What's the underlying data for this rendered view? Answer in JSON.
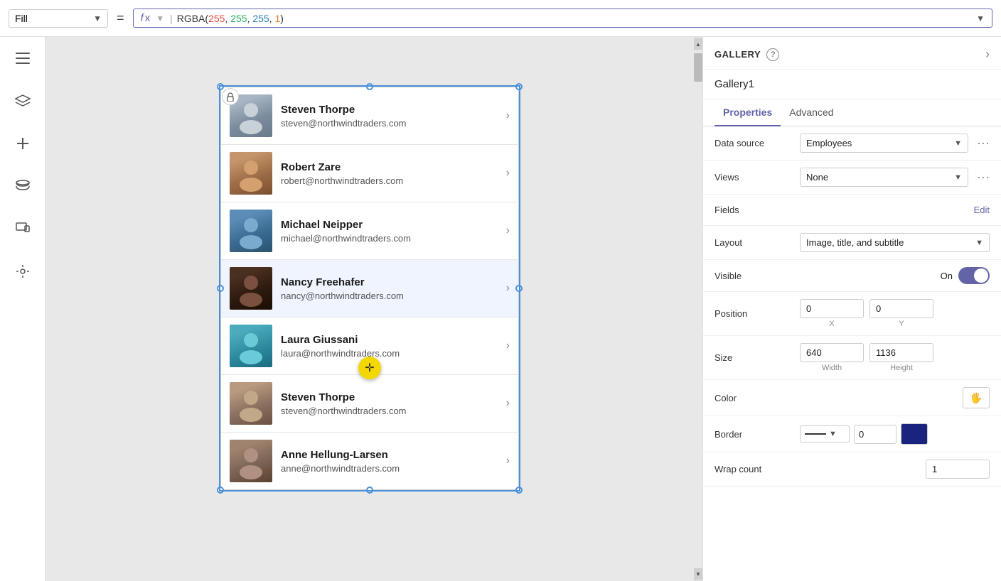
{
  "topbar": {
    "fill_label": "Fill",
    "equals": "=",
    "fx_label": "fx",
    "formula": "RGBA(255, 255, 255, 1)",
    "formula_parts": {
      "prefix": "RGBA(",
      "r": "255",
      "comma1": ", ",
      "g": "255",
      "comma2": ", ",
      "b": "255",
      "comma3": ", ",
      "a": "1",
      "suffix": ")"
    }
  },
  "sidebar": {
    "icons": [
      "menu",
      "layers",
      "plus",
      "database",
      "screen",
      "tools"
    ]
  },
  "gallery": {
    "title": "GALLERY",
    "help": "?",
    "name": "Gallery1",
    "items": [
      {
        "name": "Steven Thorpe",
        "email": "steven@northwindtraders.com",
        "avatar_color": "#8B9BB0"
      },
      {
        "name": "Robert Zare",
        "email": "robert@northwindtraders.com",
        "avatar_color": "#C4956A"
      },
      {
        "name": "Michael Neipper",
        "email": "michael@northwindtraders.com",
        "avatar_color": "#5B8DB8"
      },
      {
        "name": "Nancy Freehafer",
        "email": "nancy@northwindtraders.com",
        "avatar_color": "#3D2B1F",
        "selected": true
      },
      {
        "name": "Laura Giussani",
        "email": "laura@northwindtraders.com",
        "avatar_color": "#4AABBD"
      },
      {
        "name": "Steven Thorpe",
        "email": "steven@northwindtraders.com",
        "avatar_color": "#A0836E"
      },
      {
        "name": "Anne Hellung-Larsen",
        "email": "anne@northwindtraders.com",
        "avatar_color": "#8B7355"
      }
    ]
  },
  "properties_panel": {
    "tabs": [
      "Properties",
      "Advanced"
    ],
    "active_tab": "Properties",
    "rows": {
      "data_source": {
        "label": "Data source",
        "value": "Employees"
      },
      "views": {
        "label": "Views",
        "value": "None"
      },
      "fields": {
        "label": "Fields",
        "edit_label": "Edit"
      },
      "layout": {
        "label": "Layout",
        "value": "Image, title, and subtitle"
      },
      "visible": {
        "label": "Visible",
        "toggle_label": "On",
        "toggle_state": true
      },
      "position": {
        "label": "Position",
        "x": "0",
        "y": "0",
        "x_label": "X",
        "y_label": "Y"
      },
      "size": {
        "label": "Size",
        "width": "640",
        "height": "1136",
        "width_label": "Width",
        "height_label": "Height"
      },
      "color": {
        "label": "Color",
        "icon": "🖐"
      },
      "border": {
        "label": "Border",
        "width": "0"
      },
      "wrap_count": {
        "label": "Wrap count",
        "value": "1"
      }
    }
  }
}
